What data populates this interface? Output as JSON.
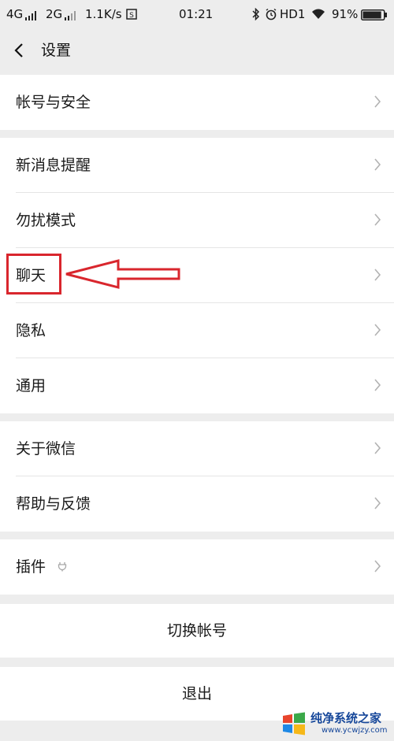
{
  "status_bar": {
    "net1": "4G",
    "net2": "2G",
    "speed": "1.1K/s",
    "time": "01:21",
    "hd": "HD1",
    "battery": "91%",
    "battery_level": 0.91
  },
  "header": {
    "title": "设置"
  },
  "groups": {
    "account": {
      "items": [
        {
          "label": "帐号与安全"
        }
      ]
    },
    "general": {
      "items": [
        {
          "label": "新消息提醒"
        },
        {
          "label": "勿扰模式"
        },
        {
          "label": "聊天"
        },
        {
          "label": "隐私"
        },
        {
          "label": "通用"
        }
      ]
    },
    "about": {
      "items": [
        {
          "label": "关于微信"
        },
        {
          "label": "帮助与反馈"
        }
      ]
    },
    "plugins": {
      "items": [
        {
          "label": "插件"
        }
      ]
    }
  },
  "actions": {
    "switch_account": "切换帐号",
    "logout": "退出"
  },
  "annotation": {
    "color": "#d9262d"
  },
  "watermark": {
    "name": "纯净系统之家",
    "url": "www.ycwjzy.com"
  }
}
